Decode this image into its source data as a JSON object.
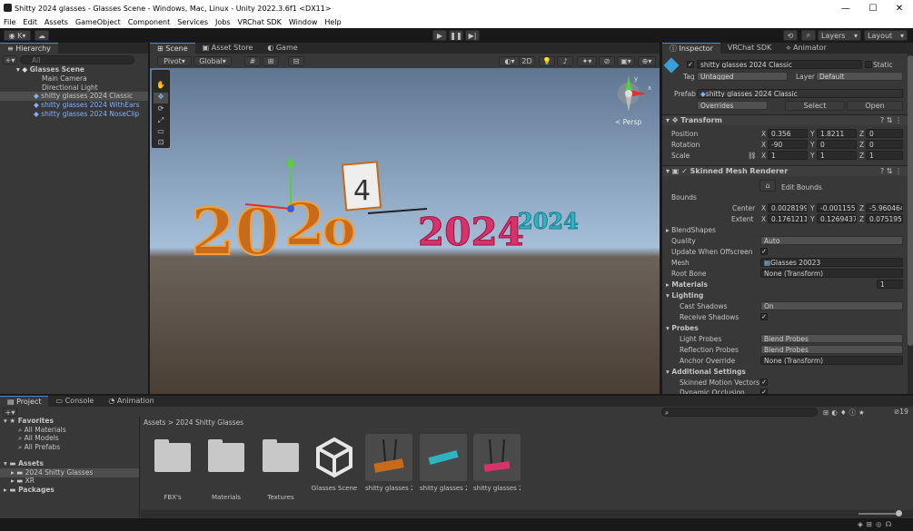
{
  "window": {
    "title": "Shitty 2024 glasses - Glasses Scene - Windows, Mac, Linux - Unity 2022.3.6f1 <DX11>",
    "min": "—",
    "max": "☐",
    "close": "✕"
  },
  "menu": [
    "File",
    "Edit",
    "Assets",
    "GameObject",
    "Component",
    "Services",
    "Jobs",
    "VRChat SDK",
    "Window",
    "Help"
  ],
  "toolbar": {
    "account": "K",
    "layers": "Layers",
    "layout": "Layout"
  },
  "hierarchy": {
    "tab": "Hierarchy",
    "search_placeholder": "All",
    "scene": "Glasses Scene",
    "items": [
      "Main Camera",
      "Directional Light",
      "shitty glasses 2024 Classic",
      "shitty glasses 2024 WithEars",
      "shitty glasses 2024 NoseClip"
    ]
  },
  "scene_view": {
    "tabs": [
      "Scene",
      "Asset Store",
      "Game"
    ],
    "pivot": "Pivot",
    "global": "Global",
    "mode_2d": "2D",
    "persp": "< Persp",
    "axis_y": "y",
    "axis_x": "x"
  },
  "inspector": {
    "tabs": [
      "Inspector",
      "VRChat SDK",
      "Animator"
    ],
    "object_name": "shitty glasses 2024 Classic",
    "static": "Static",
    "tag_label": "Tag",
    "tag": "Untagged",
    "layer_label": "Layer",
    "layer": "Default",
    "prefab_label": "Prefab",
    "prefab": "shitty glasses 2024 Classic",
    "overrides": "Overrides",
    "select": "Select",
    "open": "Open",
    "transform": {
      "title": "Transform",
      "position_label": "Position",
      "rotation_label": "Rotation",
      "scale_label": "Scale",
      "position": [
        "0.356",
        "1.8211",
        "0"
      ],
      "rotation": [
        "-90",
        "0",
        "0"
      ],
      "scale": [
        "1",
        "1",
        "1"
      ]
    },
    "smr": {
      "title": "Skinned Mesh Renderer",
      "edit_bounds": "Edit Bounds",
      "bounds": "Bounds",
      "center_label": "Center",
      "extent_label": "Extent",
      "center": [
        "0.0028199",
        "-0.001155",
        "-5.960464"
      ],
      "extent": [
        "0.1761211",
        "0.1269437",
        "0.0751956"
      ],
      "blendshapes": "BlendShapes",
      "quality_label": "Quality",
      "quality": "Auto",
      "update_offscreen": "Update When Offscreen",
      "mesh_label": "Mesh",
      "mesh": "Glasses 20023",
      "root_bone_label": "Root Bone",
      "root_bone": "None (Transform)",
      "materials": "Materials",
      "materials_count": "1",
      "lighting": "Lighting",
      "cast_shadows_label": "Cast Shadows",
      "cast_shadows": "On",
      "receive_shadows": "Receive Shadows",
      "probes": "Probes",
      "light_probes_label": "Light Probes",
      "light_probes": "Blend Probes",
      "reflection_probes_label": "Reflection Probes",
      "reflection_probes": "Blend Probes",
      "anchor_override_label": "Anchor Override",
      "anchor_override": "None (Transform)",
      "additional": "Additional Settings",
      "skinned_motion": "Skinned Motion Vectors",
      "dynamic_occlusion": "Dynamic Occlusion"
    }
  },
  "project": {
    "tabs": [
      "Project",
      "Console",
      "Animation"
    ],
    "favorites": "Favorites",
    "fav_items": [
      "All Materials",
      "All Models",
      "All Prefabs"
    ],
    "assets": "Assets",
    "asset_tree": [
      "2024 Shitty Glasses",
      "XR"
    ],
    "packages": "Packages",
    "breadcrumb": [
      "Assets",
      "2024 Shitty Glasses"
    ],
    "hidden_count": "19",
    "items": [
      "FBX's",
      "Materials",
      "Textures",
      "Glasses Scene",
      "shitty glasses 2...",
      "shitty glasses 2...",
      "shitty glasses 2..."
    ]
  },
  "colors": {
    "accent": "#4a89d8",
    "prefab_blue": "#7fb3ff",
    "sky_top": "#a6bfd9",
    "ground": "#5a4c40",
    "orange": "#c76a1a",
    "pink": "#d6336c",
    "teal": "#2fb3c0"
  }
}
